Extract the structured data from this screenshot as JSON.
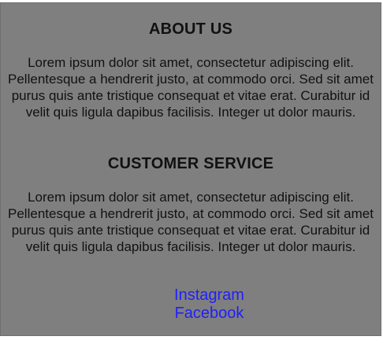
{
  "about": {
    "title": "ABOUT US",
    "text": "Lorem ipsum dolor sit amet, consectetur adipiscing elit. Pellentesque a hendrerit justo, at commodo orci. Sed sit amet purus quis ante tristique consequat et vitae erat. Curabitur id velit quis ligula dapibus facilisis. Integer ut dolor mauris."
  },
  "customer_service": {
    "title": "CUSTOMER SERVICE",
    "text": "Lorem ipsum dolor sit amet, consectetur adipiscing elit. Pellentesque a hendrerit justo, at commodo orci. Sed sit amet purus quis ante tristique consequat et vitae erat. Curabitur id velit quis ligula dapibus facilisis. Integer ut dolor mauris."
  },
  "social": {
    "instagram": "Instagram",
    "facebook": "Facebook"
  },
  "colors": {
    "panel_bg": "#7f7f7f",
    "link": "#1f1fff",
    "text": "#111111"
  }
}
